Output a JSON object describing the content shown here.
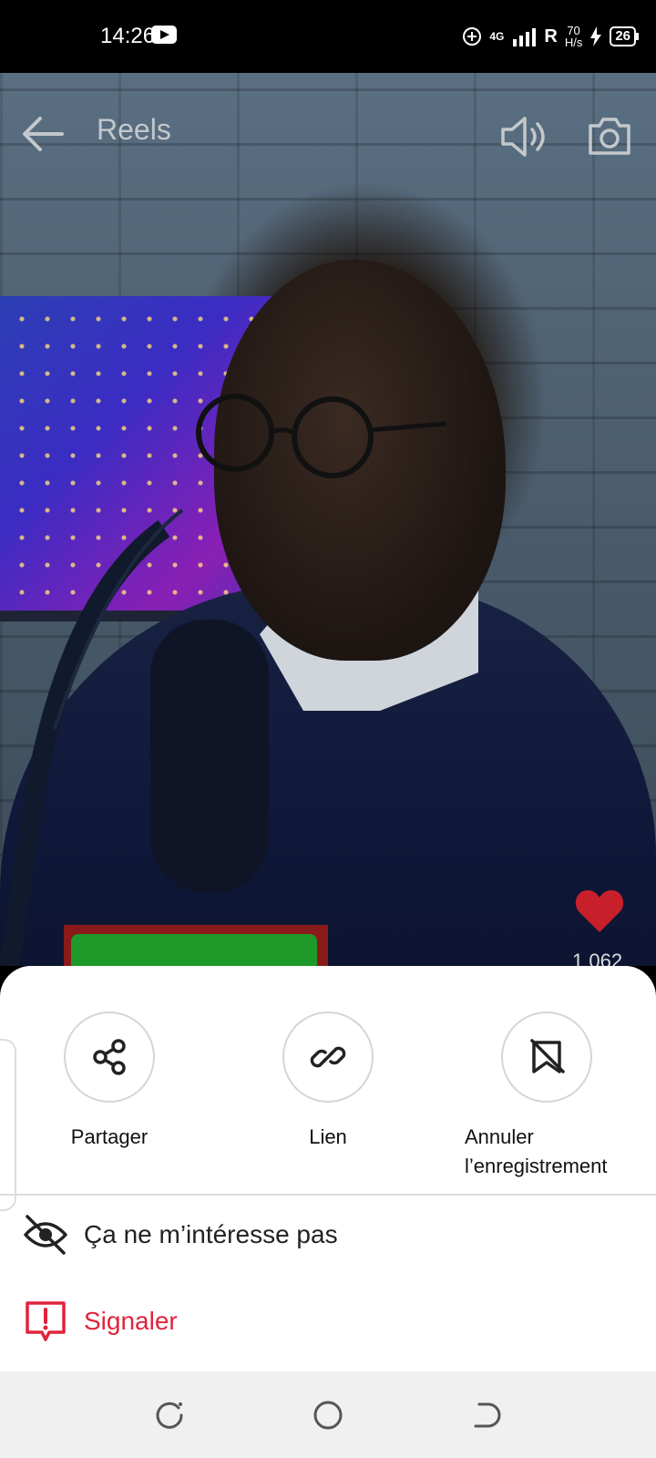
{
  "status_bar": {
    "time": "14:26",
    "network": "4G",
    "carrier": "R",
    "speed_value": "70",
    "speed_unit": "H/s",
    "battery": "26"
  },
  "header": {
    "title": "Reels",
    "icons": [
      "back-arrow-icon",
      "speaker-icon",
      "camera-icon"
    ]
  },
  "video": {
    "like_count": "1 062"
  },
  "sheet": {
    "actions": [
      {
        "label": "Partager",
        "icon": "share-icon"
      },
      {
        "label": "Lien",
        "icon": "link-icon"
      },
      {
        "label_line1": "Annuler",
        "label_line2": "l’enregistrement",
        "icon": "unsave-icon"
      }
    ],
    "options": [
      {
        "label": "Ça ne m’intéresse pas",
        "icon": "eye-off-icon"
      },
      {
        "label": "Signaler",
        "icon": "report-icon"
      }
    ]
  },
  "colors": {
    "danger": "#e0243c",
    "heart": "#c8202a"
  }
}
